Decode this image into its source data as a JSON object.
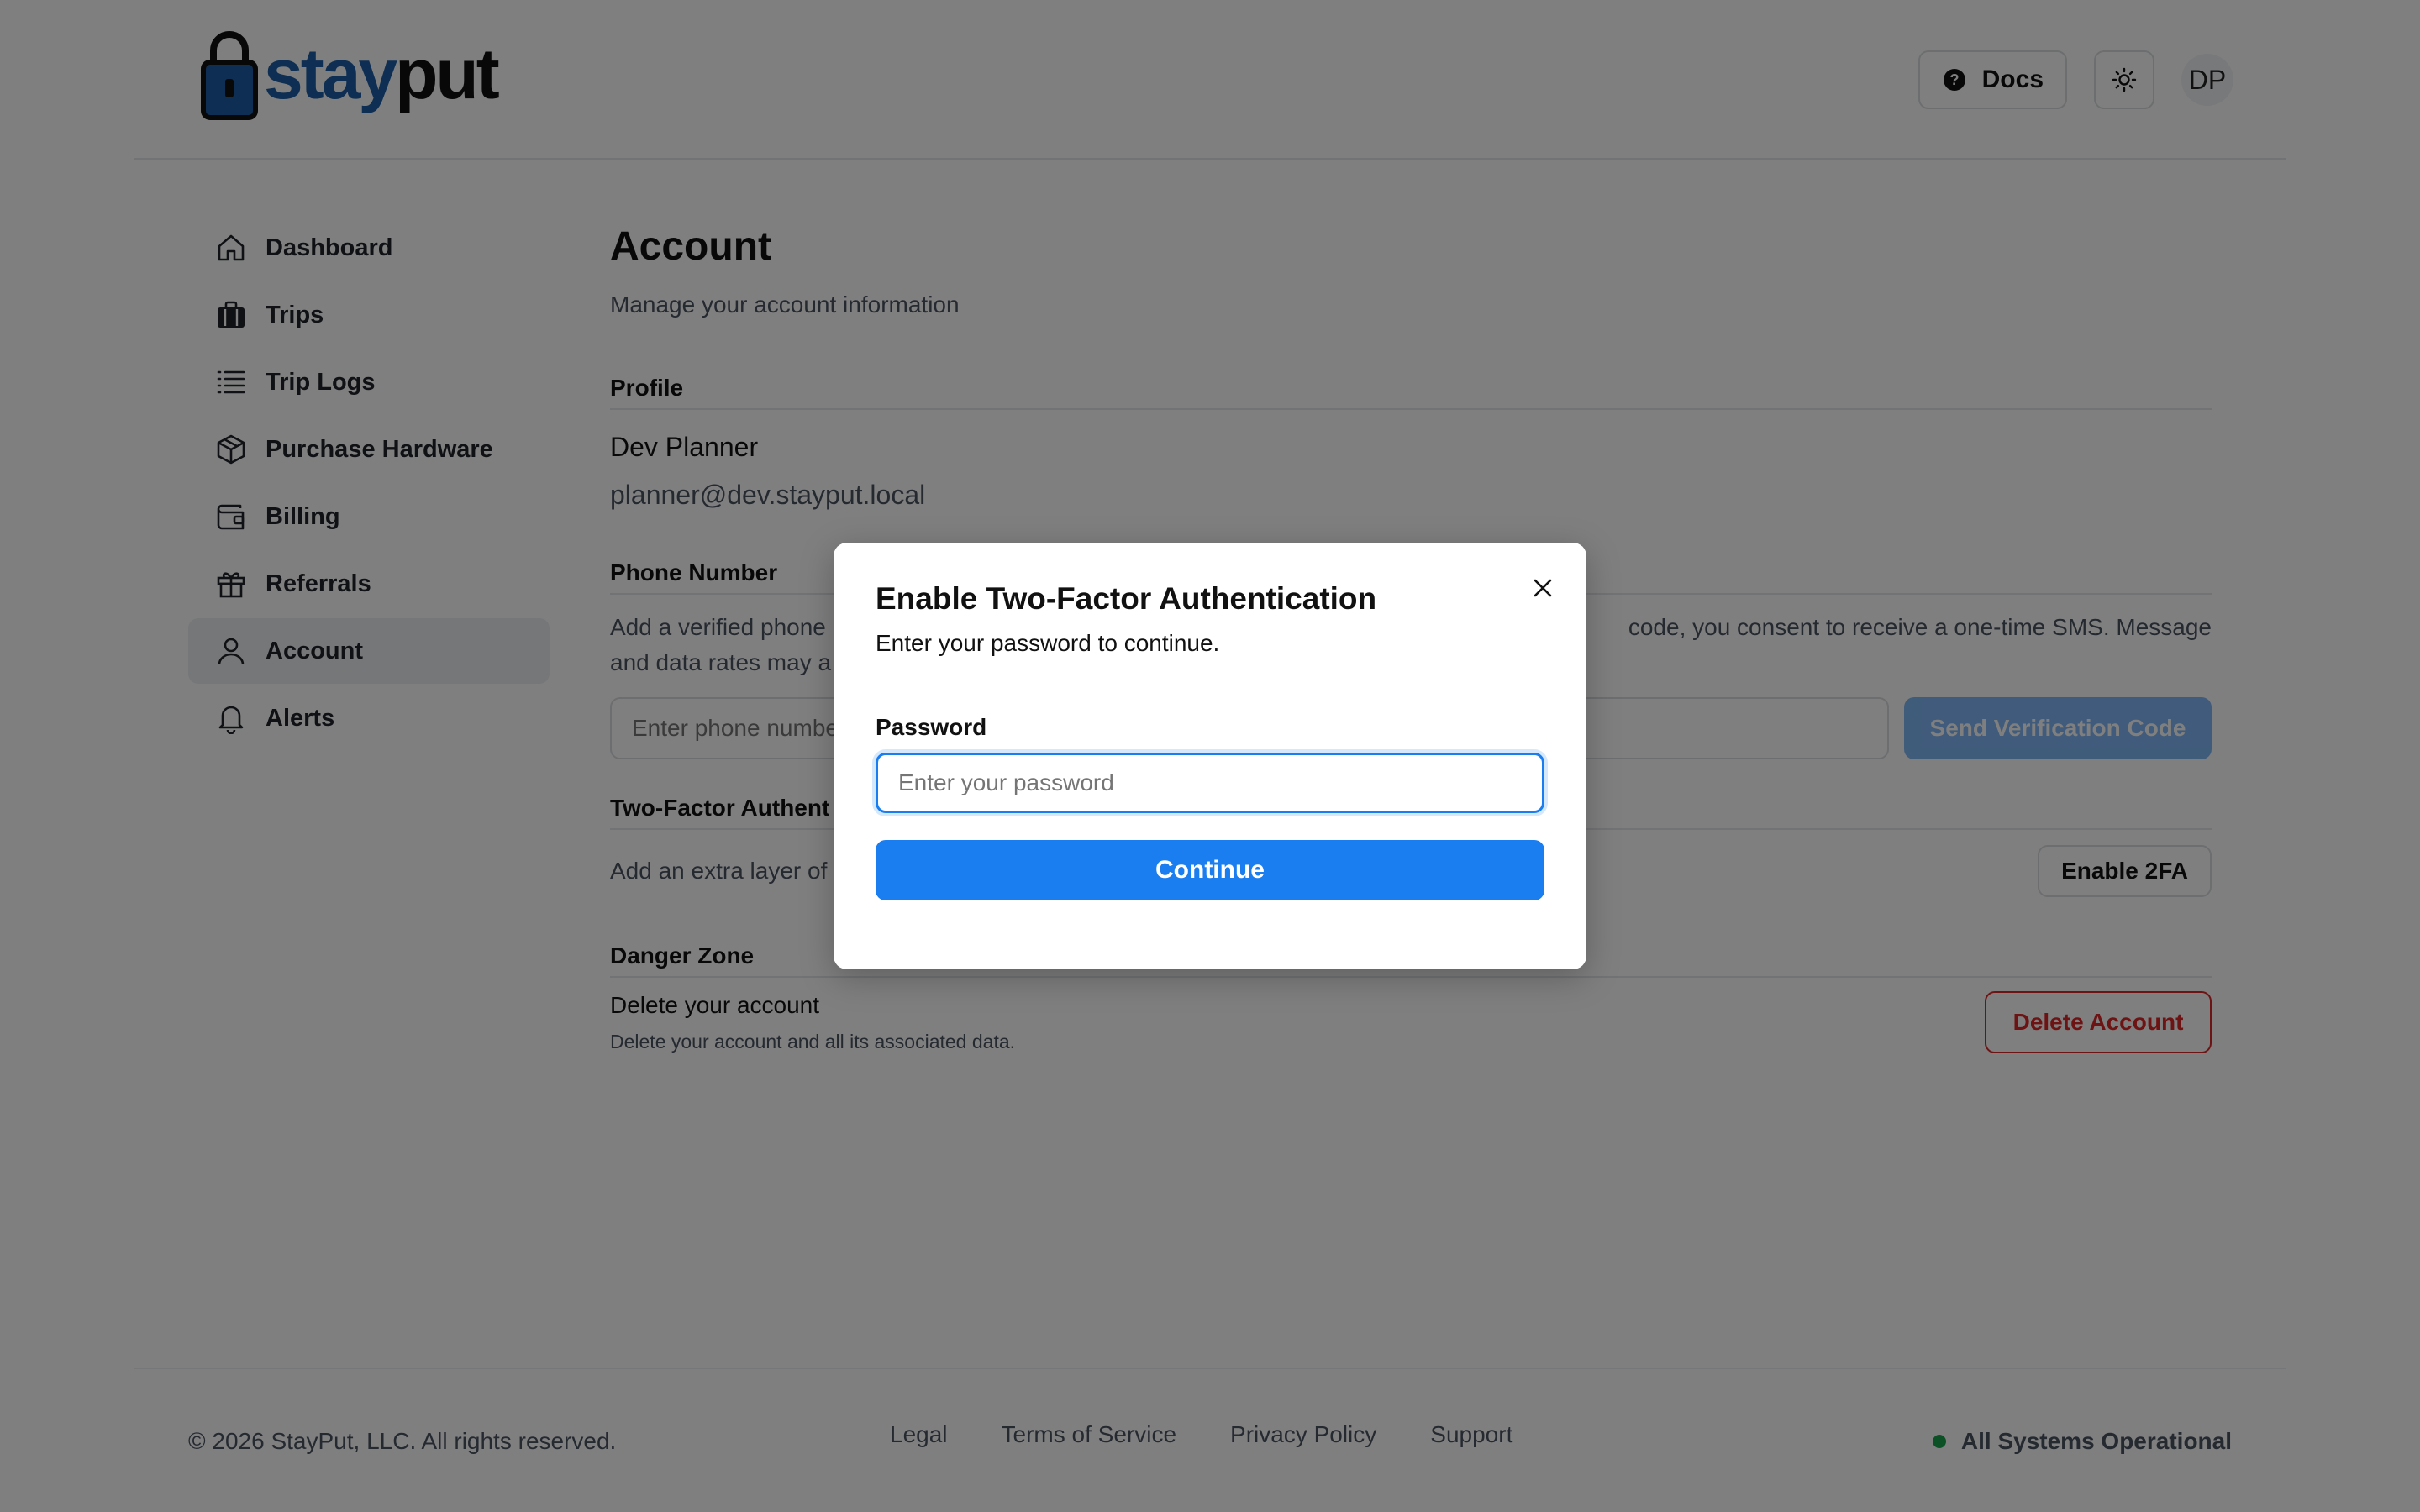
{
  "logo": {
    "part1": "stay",
    "part2": "put"
  },
  "header": {
    "docs_label": "Docs",
    "avatar_initials": "DP"
  },
  "sidebar": {
    "items": [
      {
        "label": "Dashboard",
        "icon": "home-icon"
      },
      {
        "label": "Trips",
        "icon": "luggage-icon"
      },
      {
        "label": "Trip Logs",
        "icon": "list-icon"
      },
      {
        "label": "Purchase Hardware",
        "icon": "package-icon"
      },
      {
        "label": "Billing",
        "icon": "wallet-icon"
      },
      {
        "label": "Referrals",
        "icon": "gift-icon"
      },
      {
        "label": "Account",
        "icon": "user-icon",
        "active": true
      },
      {
        "label": "Alerts",
        "icon": "bell-icon"
      }
    ]
  },
  "main": {
    "title": "Account",
    "subtitle": "Manage your account information",
    "profile": {
      "heading": "Profile",
      "name": "Dev Planner",
      "email": "planner@dev.stayput.local"
    },
    "phone": {
      "heading": "Phone Number",
      "desc_left_line1": "Add a verified phone",
      "desc_right_line1": "code, you consent to receive a one-time SMS. Message",
      "desc_left_line2": "and data rates may a",
      "placeholder": "Enter phone numbe",
      "send_label": "Send Verification Code"
    },
    "two_fa": {
      "heading": "Two-Factor Authent",
      "desc": "Add an extra layer of",
      "enable_label": "Enable 2FA"
    },
    "danger": {
      "heading": "Danger Zone",
      "title": "Delete your account",
      "desc": "Delete your account and all its associated data.",
      "delete_label": "Delete Account"
    }
  },
  "footer": {
    "copyright": "© 2026 StayPut, LLC. All rights reserved.",
    "links": [
      "Legal",
      "Terms of Service",
      "Privacy Policy",
      "Support"
    ],
    "status": "All Systems Operational"
  },
  "modal": {
    "title": "Enable Two-Factor Authentication",
    "subtitle": "Enter your password to continue.",
    "password_label": "Password",
    "password_placeholder": "Enter your password",
    "continue_label": "Continue"
  },
  "colors": {
    "accent": "#1a7ef0",
    "danger": "#dc2626",
    "status_ok": "#16a34a",
    "brand_blue": "#1d5fa6"
  }
}
